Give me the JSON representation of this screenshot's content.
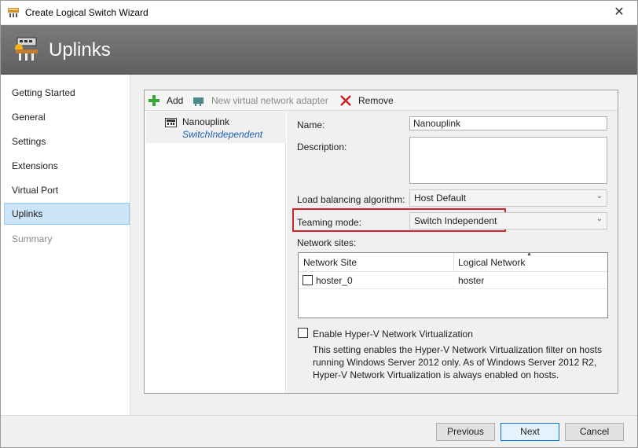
{
  "window": {
    "title": "Create Logical Switch Wizard",
    "close_glyph": "✕"
  },
  "banner": {
    "title": "Uplinks",
    "icon": "switch-wizard-icon"
  },
  "nav": {
    "items": [
      {
        "label": "Getting Started",
        "state": "normal"
      },
      {
        "label": "General",
        "state": "normal"
      },
      {
        "label": "Settings",
        "state": "normal"
      },
      {
        "label": "Extensions",
        "state": "normal"
      },
      {
        "label": "Virtual Port",
        "state": "normal"
      },
      {
        "label": "Uplinks",
        "state": "active"
      },
      {
        "label": "Summary",
        "state": "disabled"
      }
    ]
  },
  "toolbar": {
    "add_label": "Add",
    "new_adapter_label": "New virtual network adapter",
    "remove_label": "Remove"
  },
  "uplink_list": {
    "items": [
      {
        "name": "Nanouplink",
        "mode": "SwitchIndependent"
      }
    ]
  },
  "form": {
    "name_label": "Name:",
    "name_value": "Nanouplink",
    "description_label": "Description:",
    "description_value": "",
    "lb_label": "Load balancing algorithm:",
    "lb_value": "Host Default",
    "teaming_label": "Teaming mode:",
    "teaming_value": "Switch Independent",
    "network_sites_label": "Network sites:",
    "grid": {
      "headers": [
        "Network Site",
        "Logical Network"
      ],
      "rows": [
        {
          "site": "hoster_0",
          "network": "hoster",
          "checked": false
        }
      ]
    },
    "hnv_label": "Enable Hyper-V Network Virtualization",
    "hnv_checked": false,
    "hnv_description": "This setting enables the Hyper-V Network Virtualization filter on hosts running Windows Server 2012 only. As of Windows Server 2012 R2, Hyper-V Network Virtualization is always enabled on hosts."
  },
  "footer": {
    "previous_label": "Previous",
    "next_label": "Next",
    "cancel_label": "Cancel"
  },
  "colors": {
    "highlight_box": "#d3222a",
    "nav_active": "#cce4f7",
    "banner": "#6e6e6e"
  }
}
